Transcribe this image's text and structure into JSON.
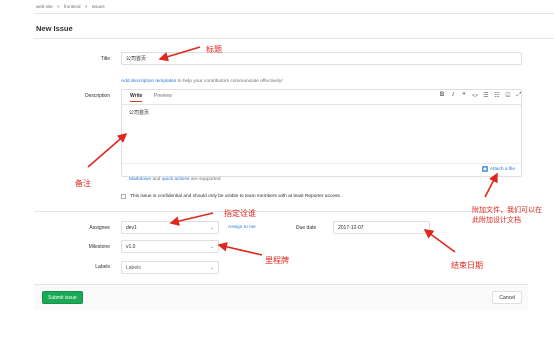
{
  "breadcrumb": {
    "items": [
      "web-site",
      ">",
      "frontend",
      ">",
      "Issues"
    ]
  },
  "page": {
    "title": "New Issue"
  },
  "form": {
    "title_label": "Title",
    "title_value": "公司首页",
    "templates_link": "Add description templates",
    "templates_help": " to help your contributors communicate effectively!",
    "description_label": "Description",
    "tab_write": "Write",
    "tab_preview": "Preview",
    "description_value": "公司首页",
    "markdown_link": "Markdown",
    "and_text": " and ",
    "quick_actions_link": "quick actions",
    "supported_text": " are supported",
    "attach_link": "Attach a file",
    "confidential_text": "This issue is confidential and should only be visible to team members with at least Reporter access.",
    "assignee_label": "Assignee",
    "assignee_value": "dev1",
    "assign_to_me": "Assign to me",
    "due_date_label": "Due date",
    "due_date_value": "2017-12-07",
    "milestone_label": "Milestone",
    "milestone_value": "v1.0",
    "labels_label": "Labels",
    "labels_value": "Labels"
  },
  "toolbar": {
    "bold": "B",
    "italic": "I",
    "quote": "❞",
    "code": "<>",
    "bullet_list": "☰",
    "numbered_list": "☷",
    "task_list": "☑",
    "fullscreen": "⤢"
  },
  "actions": {
    "submit": "Submit issue",
    "cancel": "Cancel"
  },
  "annotations": {
    "title": "标题",
    "description": "备注",
    "attach": "附加文件，我们可以在此附加设计文档",
    "assignee": "指定诠谁",
    "milestone": "里程牌",
    "due_date": "结束日期"
  },
  "colors": {
    "annotation": "#e0271d",
    "link": "#1f78d1",
    "submit": "#1aaa55"
  }
}
